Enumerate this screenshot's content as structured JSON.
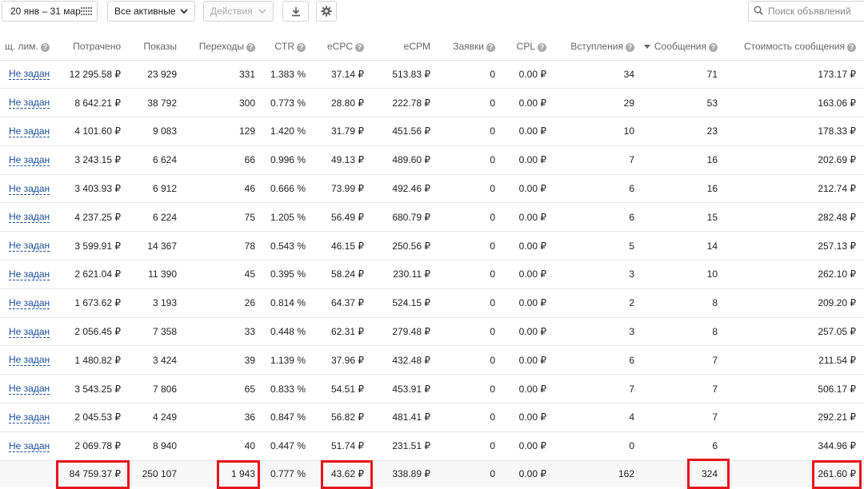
{
  "toolbar": {
    "date_range": "20 янв – 31 мар",
    "filter_label": "Все активные",
    "actions_label": "Действия",
    "search_placeholder": "Поиск объявлений",
    "icons": [
      "calendar-icon",
      "chevron-down-icon",
      "download-icon",
      "gear-icon",
      "search-icon"
    ]
  },
  "columns": [
    {
      "key": "limit",
      "label": "щ. лим.",
      "help": true
    },
    {
      "key": "spent",
      "label": "Потрачено",
      "help": false
    },
    {
      "key": "impressions",
      "label": "Показы",
      "help": false
    },
    {
      "key": "clicks",
      "label": "Переходы",
      "help": true
    },
    {
      "key": "ctr",
      "label": "CTR",
      "help": true
    },
    {
      "key": "ecpc",
      "label": "eCPC",
      "help": true
    },
    {
      "key": "ecpm",
      "label": "eCPM",
      "help": false
    },
    {
      "key": "leads",
      "label": "Заявки",
      "help": true
    },
    {
      "key": "cpl",
      "label": "CPL",
      "help": true
    },
    {
      "key": "joins",
      "label": "Вступления",
      "help": true
    },
    {
      "key": "messages",
      "label": "Сообщения",
      "help": true,
      "sorted": true
    },
    {
      "key": "msg_cost",
      "label": "Стоимость сообщения",
      "help": true
    }
  ],
  "rows": [
    [
      "Не задан",
      "12 295.58 ₽",
      "23 929",
      "331",
      "1.383 %",
      "37.14 ₽",
      "513.83 ₽",
      "0",
      "0.00 ₽",
      "34",
      "71",
      "173.17 ₽"
    ],
    [
      "Не задан",
      "8 642.21 ₽",
      "38 792",
      "300",
      "0.773 %",
      "28.80 ₽",
      "222.78 ₽",
      "0",
      "0.00 ₽",
      "29",
      "53",
      "163.06 ₽"
    ],
    [
      "Не задан",
      "4 101.60 ₽",
      "9 083",
      "129",
      "1.420 %",
      "31.79 ₽",
      "451.56 ₽",
      "0",
      "0.00 ₽",
      "10",
      "23",
      "178.33 ₽"
    ],
    [
      "Не задан",
      "3 243.15 ₽",
      "6 624",
      "66",
      "0.996 %",
      "49.13 ₽",
      "489.60 ₽",
      "0",
      "0.00 ₽",
      "7",
      "16",
      "202.69 ₽"
    ],
    [
      "Не задан",
      "3 403.93 ₽",
      "6 912",
      "46",
      "0.666 %",
      "73.99 ₽",
      "492.46 ₽",
      "0",
      "0.00 ₽",
      "6",
      "16",
      "212.74 ₽"
    ],
    [
      "Не задан",
      "4 237.25 ₽",
      "6 224",
      "75",
      "1.205 %",
      "56.49 ₽",
      "680.79 ₽",
      "0",
      "0.00 ₽",
      "6",
      "15",
      "282.48 ₽"
    ],
    [
      "Не задан",
      "3 599.91 ₽",
      "14 367",
      "78",
      "0.543 %",
      "46.15 ₽",
      "250.56 ₽",
      "0",
      "0.00 ₽",
      "5",
      "14",
      "257.13 ₽"
    ],
    [
      "Не задан",
      "2 621.04 ₽",
      "11 390",
      "45",
      "0.395 %",
      "58.24 ₽",
      "230.11 ₽",
      "0",
      "0.00 ₽",
      "3",
      "10",
      "262.10 ₽"
    ],
    [
      "Не задан",
      "1 673.62 ₽",
      "3 193",
      "26",
      "0.814 %",
      "64.37 ₽",
      "524.15 ₽",
      "0",
      "0.00 ₽",
      "2",
      "8",
      "209.20 ₽"
    ],
    [
      "Не задан",
      "2 056.45 ₽",
      "7 358",
      "33",
      "0.448 %",
      "62.31 ₽",
      "279.48 ₽",
      "0",
      "0.00 ₽",
      "3",
      "8",
      "257.05 ₽"
    ],
    [
      "Не задан",
      "1 480.82 ₽",
      "3 424",
      "39",
      "1.139 %",
      "37.96 ₽",
      "432.48 ₽",
      "0",
      "0.00 ₽",
      "6",
      "7",
      "211.54 ₽"
    ],
    [
      "Не задан",
      "3 543.25 ₽",
      "7 806",
      "65",
      "0.833 %",
      "54.51 ₽",
      "453.91 ₽",
      "0",
      "0.00 ₽",
      "7",
      "7",
      "506.17 ₽"
    ],
    [
      "Не задан",
      "2 045.53 ₽",
      "4 249",
      "36",
      "0.847 %",
      "56.82 ₽",
      "481.41 ₽",
      "0",
      "0.00 ₽",
      "4",
      "7",
      "292.21 ₽"
    ],
    [
      "Не задан",
      "2 069.78 ₽",
      "8 940",
      "40",
      "0.447 %",
      "51.74 ₽",
      "231.51 ₽",
      "0",
      "0.00 ₽",
      "0",
      "6",
      "344.96 ₽"
    ]
  ],
  "totals": [
    "",
    "84 759.37 ₽",
    "250 107",
    "1 943",
    "0.777 %",
    "43.62 ₽",
    "338.89 ₽",
    "0",
    "0.00 ₽",
    "162",
    "324",
    "261.60 ₽"
  ],
  "highlight_color": "#e8141c",
  "highlighted_totals": [
    "spent",
    "clicks",
    "ecpc",
    "messages",
    "msg_cost"
  ]
}
